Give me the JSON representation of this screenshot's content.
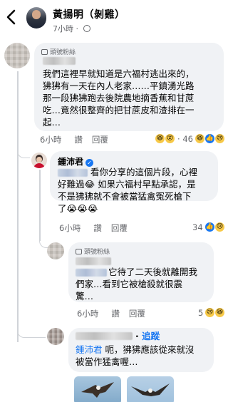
{
  "header": {
    "back_icon": "chevron-left-icon",
    "name": "黃揚明（剝雞）",
    "time": "7小時",
    "privacy_icon": "globe-icon"
  },
  "comment1": {
    "badge": "頭號粉絲",
    "text_lines": [
      "我們這裡早就知道是六福村逃出來的，",
      "狒狒有一天在內人老家……平鎮湧光路",
      "那一段狒狒跑去後院農地摘香蕉和甘蔗",
      "吃…竟然很整齊的把甘蔗皮和渣排在一",
      "起…"
    ],
    "time": "6小時",
    "like": "讚",
    "reply": "回覆",
    "reaction_count": "46"
  },
  "reply1": {
    "author": "鍾沛君",
    "text_lines": [
      "看你分享的這個片段，心裡",
      "好難過😂 如果六福村早點承認，是",
      "不是狒狒就不會被當猛禽冤死槍下",
      "了😭😭😭"
    ],
    "time": "6小時",
    "like": "讚",
    "reply": "回覆",
    "reaction_count": "34"
  },
  "reply2": {
    "badge": "頭號粉絲",
    "text_lines": [
      "它待了二天後就離開我",
      "們家…看到它被槍殺就很震",
      "驚…"
    ],
    "time": "6小時",
    "like": "讚",
    "reply": "回覆",
    "reaction_count": "5"
  },
  "reply3": {
    "follow": "追蹤",
    "mention": "鍾沛君",
    "text_lines": [
      " 呃，狒狒應該從來就沒",
      "被當作猛禽喔…"
    ]
  },
  "colors": {
    "link": "#1877f2",
    "muted": "#65676b",
    "bubble": "#f0f2f5"
  }
}
